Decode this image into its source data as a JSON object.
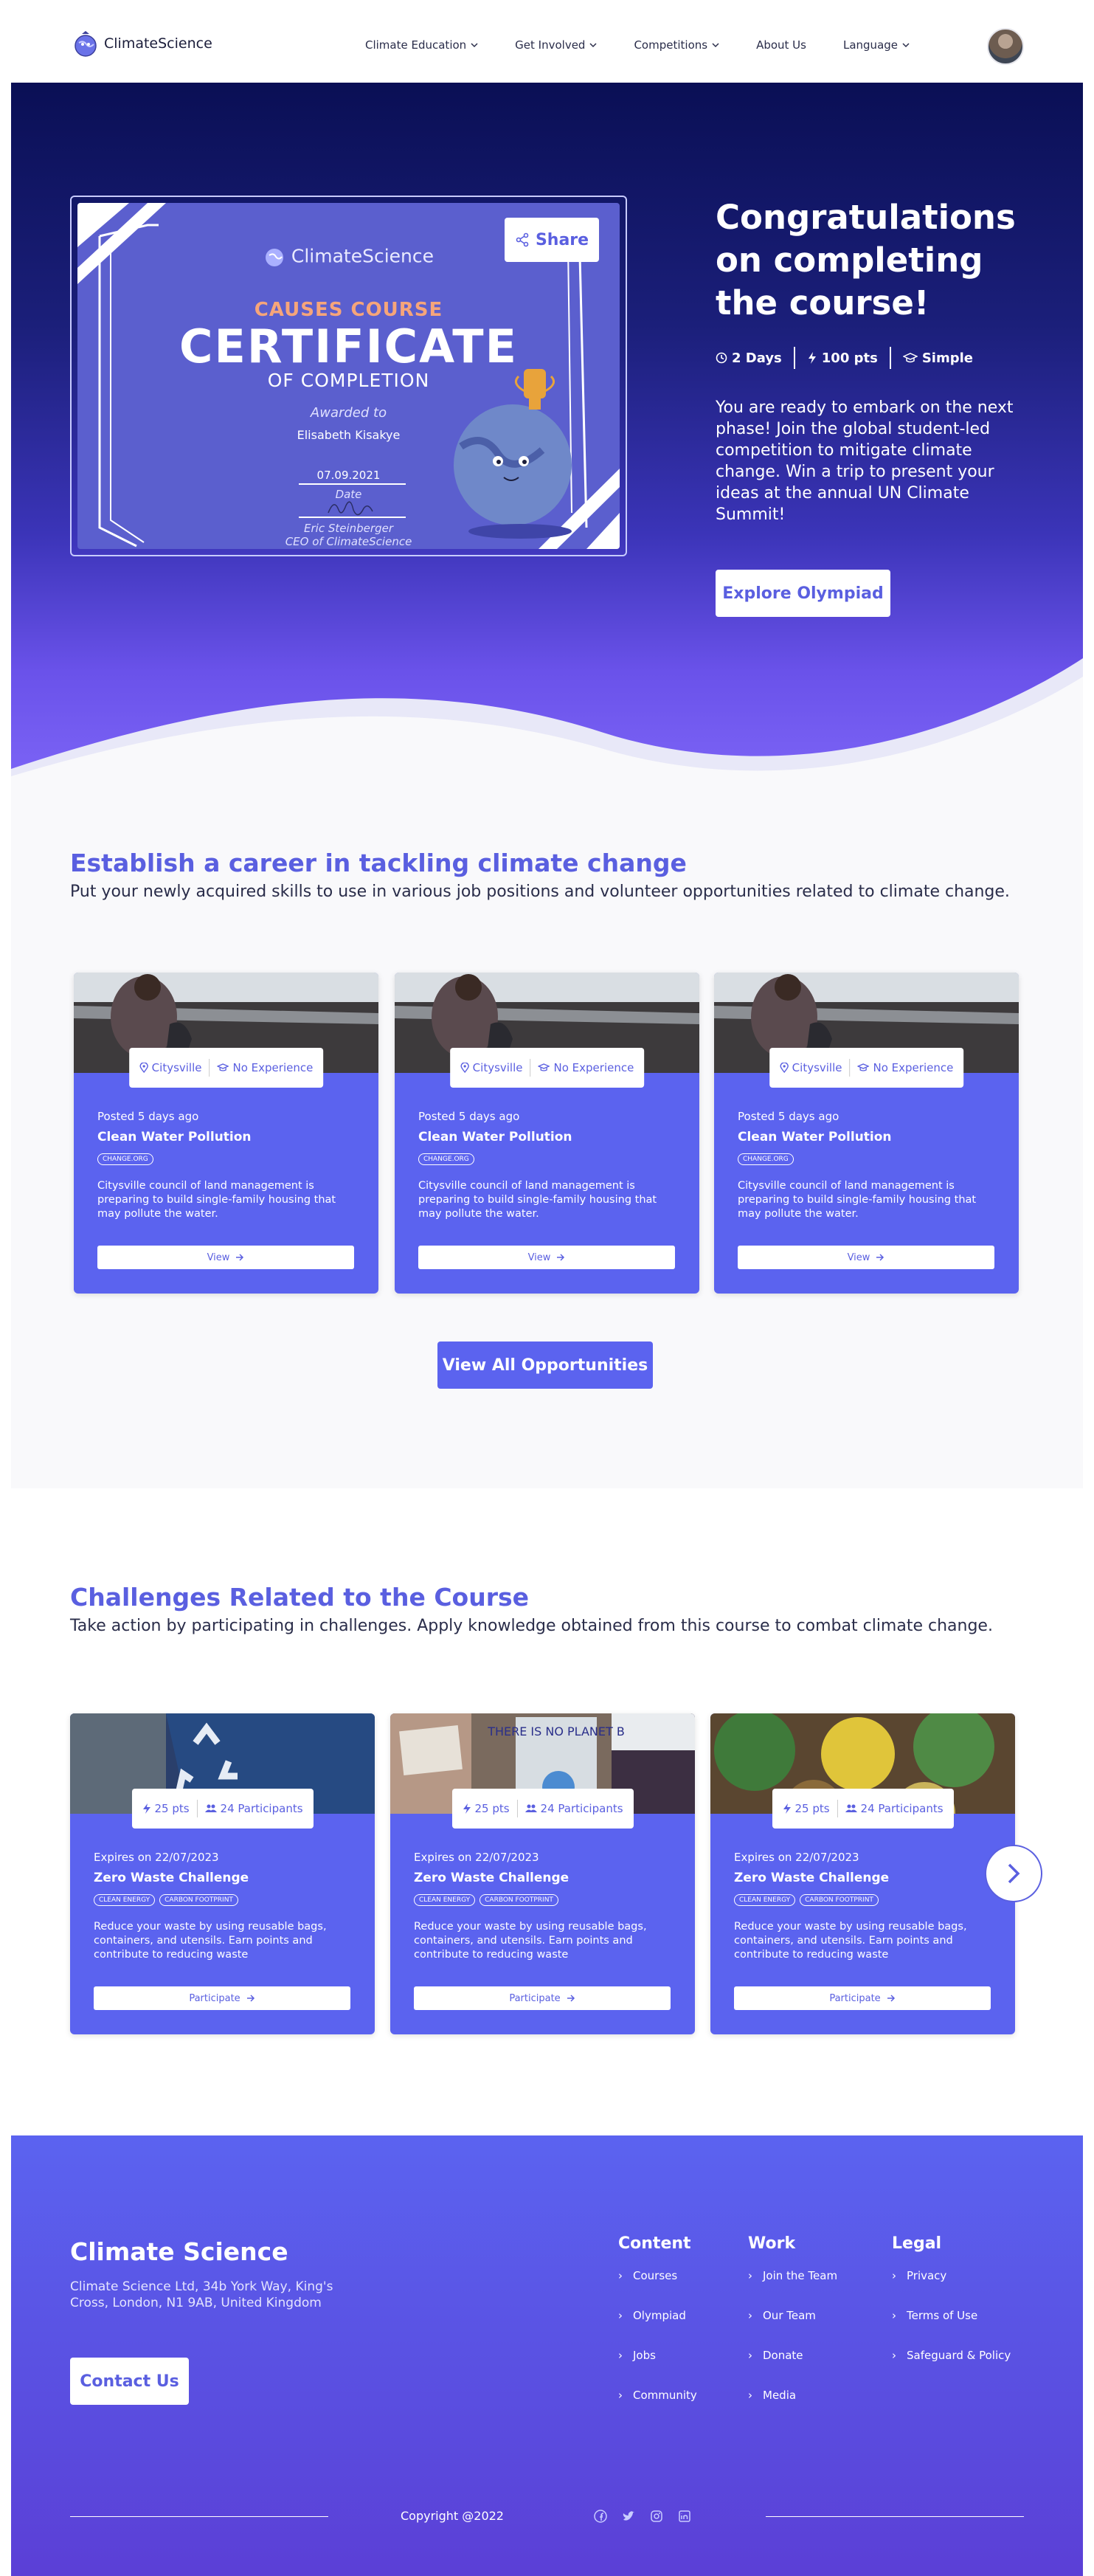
{
  "nav": {
    "brand": "ClimateScience",
    "items": [
      {
        "label": "Climate Education",
        "dropdown": true
      },
      {
        "label": "Get Involved",
        "dropdown": true
      },
      {
        "label": "Competitions",
        "dropdown": true
      },
      {
        "label": "About Us",
        "dropdown": false
      },
      {
        "label": "Language",
        "dropdown": true
      }
    ]
  },
  "certificate": {
    "share_label": "Share",
    "brand": "ClimateScience",
    "course": "CAUSES COURSE",
    "title": "CERTIFICATE",
    "subtitle": "OF COMPLETION",
    "awarded_to": "Awarded to",
    "name": "Elisabeth Kisakye",
    "date": "07.09.2021",
    "date_label": "Date",
    "signer": "Eric Steinberger",
    "signer_role": "CEO of ClimateScience"
  },
  "hero": {
    "title": "Congratulations on completing the course!",
    "meta": {
      "duration": "2 Days",
      "points": "100 pts",
      "difficulty": "Simple"
    },
    "text": "You are ready to embark on the next phase! Join the global student-led competition to mitigate climate change. Win a trip to present your ideas at the annual UN Climate Summit!",
    "cta": "Explore Olympiad"
  },
  "career": {
    "title": "Establish a career in tackling climate change",
    "description": "Put your newly acquired skills to use in various job positions and volunteer opportunities related to climate change.",
    "cards": [
      {
        "location": "Citysville",
        "experience": "No Experience",
        "posted": "Posted 5 days ago",
        "title": "Clean Water Pollution",
        "org": "CHANGE.ORG",
        "desc": "Citysville council of land management is preparing to build single-family housing that may pollute the water.",
        "button": "View"
      },
      {
        "location": "Citysville",
        "experience": "No Experience",
        "posted": "Posted 5 days ago",
        "title": "Clean Water Pollution",
        "org": "CHANGE.ORG",
        "desc": "Citysville council of land management is preparing to build single-family housing that may pollute the water.",
        "button": "View"
      },
      {
        "location": "Citysville",
        "experience": "No Experience",
        "posted": "Posted 5 days ago",
        "title": "Clean Water Pollution",
        "org": "CHANGE.ORG",
        "desc": "Citysville council of land management is preparing to build single-family housing that may pollute the water.",
        "button": "View"
      }
    ],
    "view_all": "View All Opportunities"
  },
  "challenges": {
    "title": "Challenges Related to the Course",
    "description": "Take action by participating in challenges. Apply knowledge obtained from this course to combat climate change.",
    "cards": [
      {
        "points": "25 pts",
        "participants": "24 Participants",
        "expires": "Expires on 22/07/2023",
        "title": "Zero Waste Challenge",
        "chips": [
          "CLEAN ENERGY",
          "CARBON FOOTPRINT"
        ],
        "desc": "Reduce your waste by using reusable bags, containers, and utensils. Earn points and contribute to reducing waste",
        "button": "Participate"
      },
      {
        "points": "25 pts",
        "participants": "24 Participants",
        "expires": "Expires on 22/07/2023",
        "title": "Zero Waste Challenge",
        "chips": [
          "CLEAN ENERGY",
          "CARBON FOOTPRINT"
        ],
        "desc": "Reduce your waste by using reusable bags, containers, and utensils. Earn points and contribute to reducing waste",
        "button": "Participate",
        "photo_sign": "THERE IS NO PLANET B"
      },
      {
        "points": "25 pts",
        "participants": "24 Participants",
        "expires": "Expires on 22/07/2023",
        "title": "Zero Waste Challenge",
        "chips": [
          "CLEAN ENERGY",
          "CARBON FOOTPRINT"
        ],
        "desc": "Reduce your waste by using reusable bags, containers, and utensils. Earn points and contribute to reducing waste",
        "button": "Participate"
      }
    ]
  },
  "footer": {
    "title": "Climate Science",
    "address": "Climate Science Ltd, 34b York Way, King's Cross, London, N1 9AB, United Kingdom",
    "contact": "Contact Us",
    "columns": [
      {
        "title": "Content",
        "links": [
          "Courses",
          "Olympiad",
          "Jobs",
          "Community"
        ]
      },
      {
        "title": "Work",
        "links": [
          "Join the Team",
          "Our Team",
          "Donate",
          "Media"
        ]
      },
      {
        "title": "Legal",
        "links": [
          "Privacy",
          "Terms of Use",
          "Safeguard & Policy"
        ]
      }
    ],
    "copyright": "Copyright @2022"
  },
  "colors": {
    "accent": "#5b63ef",
    "hero_dark": "#0a0f55",
    "cert_orange": "#f6a57a"
  }
}
